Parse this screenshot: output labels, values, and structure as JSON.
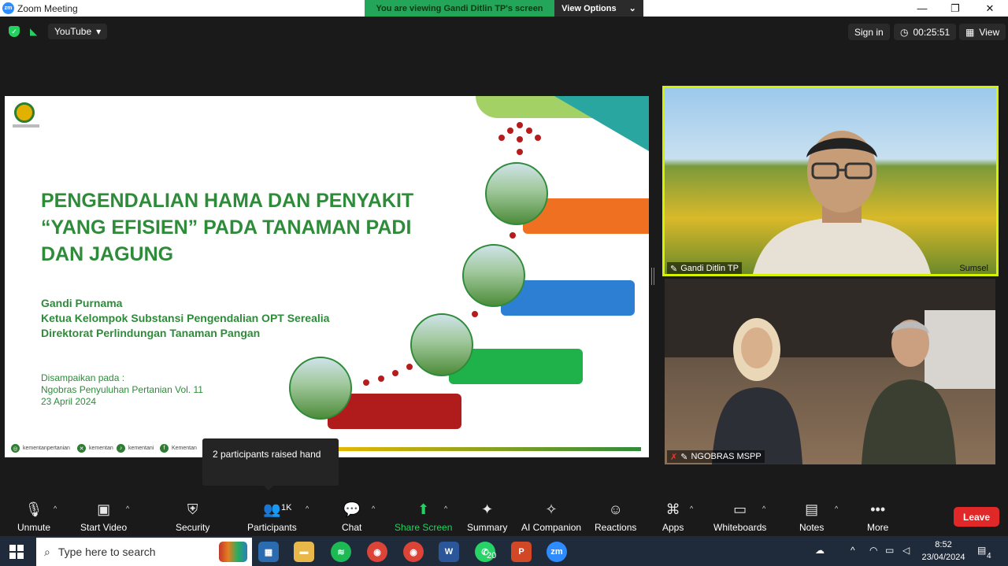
{
  "window": {
    "app_badge": "zm",
    "title": "Zoom Meeting",
    "min": "—",
    "max": "❐",
    "close": "✕"
  },
  "banner": {
    "text": "You are viewing Gandi Ditlin TP's screen",
    "view_options": "View Options",
    "caret": "⌄"
  },
  "topbar": {
    "youtube": "YouTube",
    "caret": "▾",
    "sign_in": "Sign in",
    "timer": "00:25:51",
    "view": "View"
  },
  "slide": {
    "title_line1": "PENGENDALIAN HAMA DAN PENYAKIT",
    "title_line2": "“YANG EFISIEN” PADA TANAMAN PADI",
    "title_line3": "DAN JAGUNG",
    "presenter": "Gandi Purnama",
    "position": "Ketua Kelompok Substansi Pengendalian OPT Serealia",
    "directorate": "Direktorat Perlindungan Tanaman Pangan",
    "delivered_label": "Disampaikan pada :",
    "event": "Ngobras Penyuluhan Pertanian Vol. 11",
    "date": "23 April 2024",
    "social": [
      "kementanpertanian",
      "kementan",
      "kementani",
      "Kementan"
    ],
    "bar_colors": [
      "#f07021",
      "#2d7fd3",
      "#1fb24a",
      "#b01c1c"
    ]
  },
  "videos": {
    "top": {
      "name": "Gandi Ditlin TP",
      "location": "Sumsel"
    },
    "bottom": {
      "name": "NGOBRAS MSPP"
    }
  },
  "tooltip": {
    "text": "2 participants raised hand"
  },
  "toolbar": {
    "unmute": "Unmute",
    "start_video": "Start Video",
    "security": "Security",
    "participants": "Participants",
    "participants_count": "1K",
    "chat": "Chat",
    "share_screen": "Share Screen",
    "summary": "Summary",
    "ai_companion": "AI Companion",
    "reactions": "Reactions",
    "apps": "Apps",
    "whiteboards": "Whiteboards",
    "notes": "Notes",
    "more": "More",
    "leave": "Leave"
  },
  "taskbar": {
    "search_placeholder": "Type here to search",
    "whatsapp_badge": "20",
    "time": "8:52",
    "date": "23/04/2024",
    "notification_count": "4",
    "apps": {
      "zoom": "zm",
      "word": "W",
      "powerpoint": "P"
    }
  }
}
